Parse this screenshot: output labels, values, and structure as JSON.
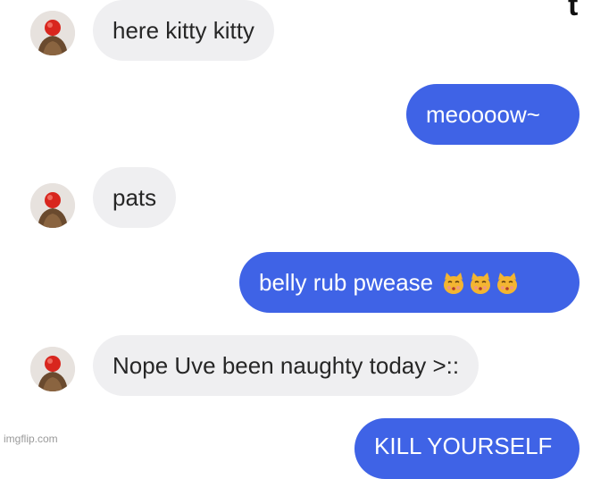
{
  "messages": [
    {
      "sender": "other",
      "text": "here kitty kitty"
    },
    {
      "sender": "me",
      "text": "meoooow~"
    },
    {
      "sender": "other",
      "text": "pats"
    },
    {
      "sender": "me",
      "text": "belly rub pwease",
      "emoji": [
        "kissing-cat",
        "kissing-cat",
        "kissing-cat"
      ]
    },
    {
      "sender": "other",
      "text": "Nope Uve been naughty today >::"
    },
    {
      "sender": "me",
      "text": "KILL YOURSELF"
    }
  ],
  "corner_glyph": "t",
  "watermark": "imgflip.com",
  "colors": {
    "outgoing_bubble": "#3f63e6",
    "incoming_bubble": "#efeff1",
    "incoming_text": "#262626",
    "outgoing_text": "#ffffff",
    "background": "#ffffff"
  }
}
